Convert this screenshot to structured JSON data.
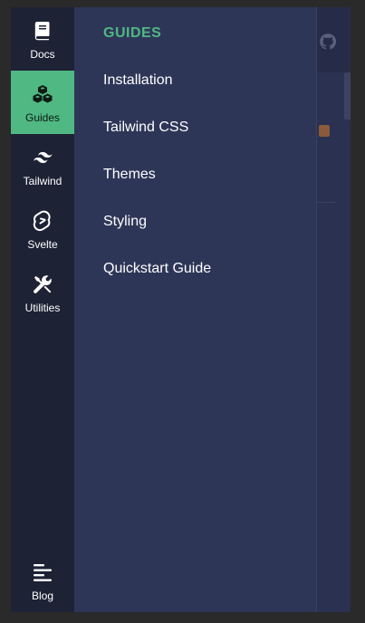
{
  "rail": {
    "items": [
      {
        "label": "Docs",
        "icon": "book-icon"
      },
      {
        "label": "Guides",
        "icon": "cubes-icon"
      },
      {
        "label": "Tailwind",
        "icon": "tailwind-icon"
      },
      {
        "label": "Svelte",
        "icon": "svelte-icon"
      },
      {
        "label": "Utilities",
        "icon": "tools-icon"
      }
    ],
    "blog": {
      "label": "Blog",
      "icon": "bars-icon"
    }
  },
  "drawer": {
    "title": "GUIDES",
    "links": [
      {
        "label": "Installation"
      },
      {
        "label": "Tailwind CSS"
      },
      {
        "label": "Themes"
      },
      {
        "label": "Styling"
      },
      {
        "label": "Quickstart Guide"
      }
    ]
  },
  "background": {
    "github_icon": "github-icon",
    "rss_icon": "rss-icon"
  },
  "colors": {
    "accent": "#4fb883",
    "rail_bg": "#1e2235",
    "drawer_bg": "#2e3658"
  }
}
